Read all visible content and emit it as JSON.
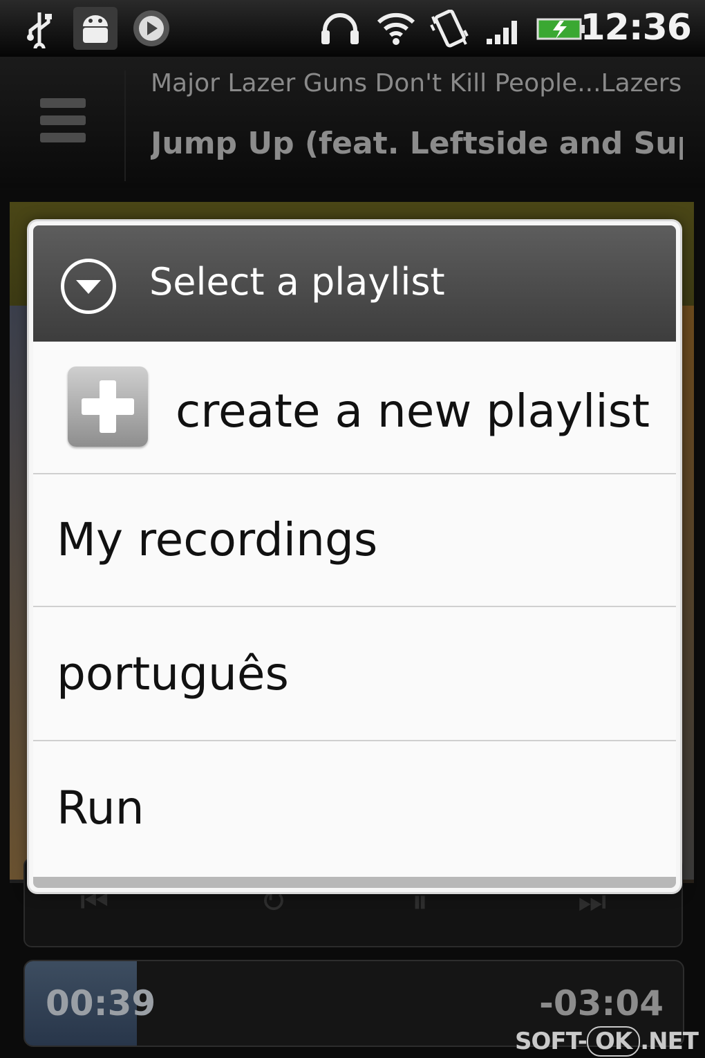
{
  "status_bar": {
    "time": "12:36",
    "icons": [
      "usb-icon",
      "android-debug-icon",
      "play-notification-icon",
      "headphones-icon",
      "wifi-icon",
      "vibrate-icon",
      "signal-icon",
      "battery-charging-icon"
    ]
  },
  "now_playing": {
    "artist_album": "Major Lazer Guns Don't Kill People...Lazers Do",
    "title": "Jump Up (feat. Leftside and Supahype)"
  },
  "dialog": {
    "title": "Select a playlist",
    "create_label": "create a new playlist",
    "playlists": [
      {
        "label": "My recordings"
      },
      {
        "label": "português"
      },
      {
        "label": "Run"
      }
    ]
  },
  "progress": {
    "elapsed": "00:39",
    "remaining": "-03:04",
    "fraction": 0.17
  },
  "watermark": {
    "left": "SOFT-",
    "mid": "OK",
    "right": ".NET"
  }
}
